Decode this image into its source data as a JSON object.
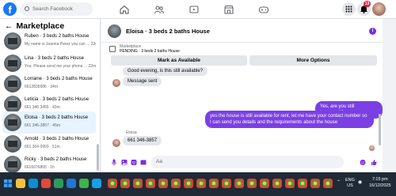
{
  "topbar": {
    "logo": "f",
    "search_placeholder": "Search Facebook",
    "notification_count": "13"
  },
  "sidebar": {
    "title": "Marketplace",
    "conversations": [
      {
        "title": "Ruben · 3 beds 2 baths House",
        "preview": "My name is Joanna Perez you can ... 22m",
        "active": false
      },
      {
        "title": "Lina · 3 beds 2 baths House",
        "preview": "You: Please send me your phone ... 22m",
        "active": false
      },
      {
        "title": "Lorraine · 3 beds 2 baths House",
        "preview": "6612835686 · 34m",
        "active": false
      },
      {
        "title": "Leticia · 3 beds 2 baths House",
        "preview": "661 346 3455 · 43m",
        "active": false
      },
      {
        "title": "Eloisa · 3 beds 2 baths House",
        "preview": "661 346-3857 · 45m",
        "active": true
      },
      {
        "title": "Arnold · 3 beds 2 baths House",
        "preview": "661 304 0993 · 51m",
        "active": false
      },
      {
        "title": "Ricky · 3 beds 2 baths House",
        "preview": "6616076865 · 1h",
        "active": false
      }
    ]
  },
  "chat": {
    "title": "Eloisa · 3 beds 2 baths House",
    "marketplace_label": "Marketplace",
    "listing_status": "PENDING · 3 beds 2 baths House",
    "mark_available_label": "Mark as Available",
    "more_options_label": "More Options",
    "messages": [
      {
        "dir": "in",
        "text": "Good evening, is this still available?"
      },
      {
        "dir": "in",
        "text": "Message sent"
      },
      {
        "dir": "out",
        "text": "Yes, are you still interested?"
      },
      {
        "dir": "out",
        "text": "yes the house is still available for rent, let me have your contact number so I can send you details and the requirements about the house"
      },
      {
        "dir": "in",
        "sender": "Eloisa",
        "text": "661 346-3857"
      }
    ],
    "composer_placeholder": "Aa"
  },
  "taskbar": {
    "time": "7:15 pm",
    "date": "16/12/2025",
    "lang": "ENG",
    "region": "US"
  },
  "colors": {
    "brand": "#1877f2",
    "accent_purple": "#7b3fe4",
    "badge": "#e41e3f"
  }
}
